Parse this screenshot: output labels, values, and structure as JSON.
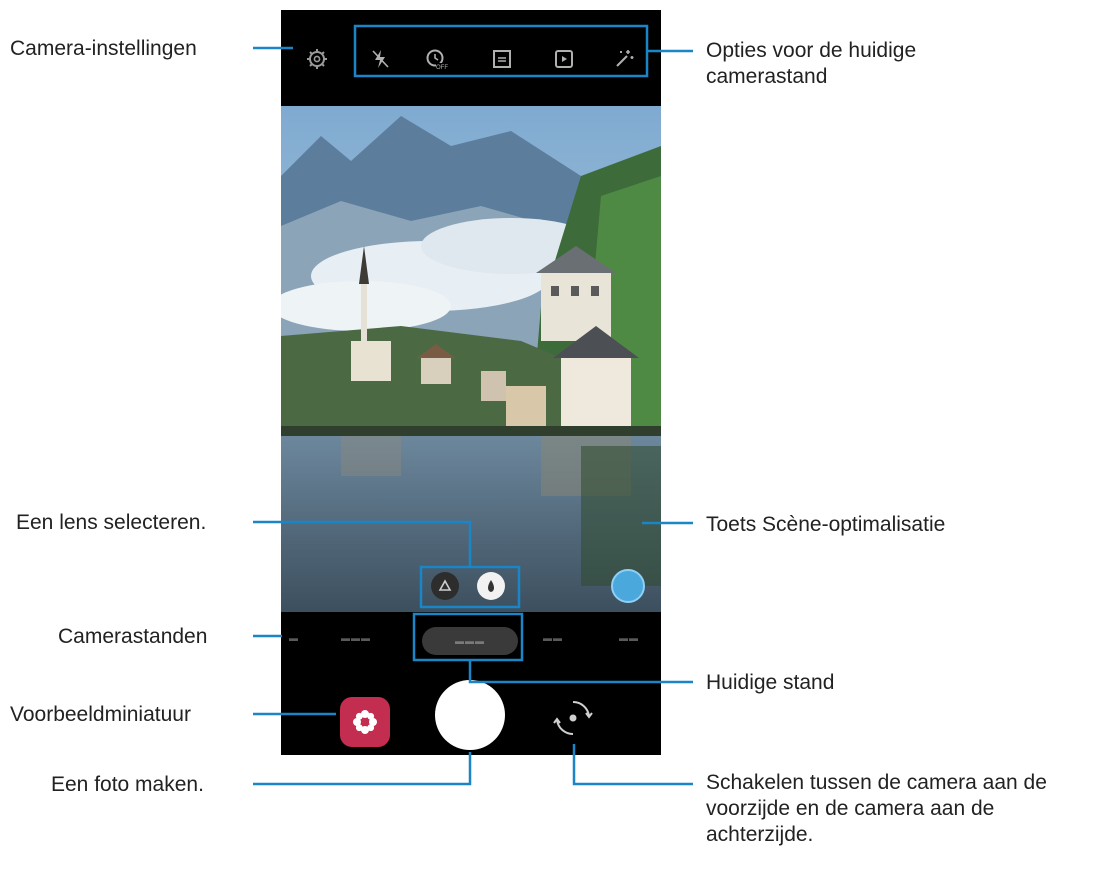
{
  "callouts": {
    "camera_settings": "Camera-instellingen",
    "mode_options": "Opties voor de huidige camerastand",
    "lens_select": "Een lens selecteren.",
    "scene_optimizer": "Toets Scène-optimalisatie",
    "camera_modes": "Camerastanden",
    "current_mode": "Huidige stand",
    "preview_thumbnail": "Voorbeeldminiatuur",
    "take_photo": "Een foto maken.",
    "switch_camera": "Schakelen tussen de camera aan de voorzijde en de camera aan de achterzijde."
  },
  "top_icons": [
    "gear-icon",
    "flash-off-icon",
    "timer-off-icon",
    "aspect-ratio-icon",
    "motion-photo-icon",
    "filter-icon"
  ],
  "lenses": [
    "wide-angle-icon",
    "standard-lens-icon"
  ],
  "colors": {
    "callout_line": "#1a86c7",
    "shutter": "#ffffff",
    "thumbnail": "#c22d50",
    "scene_button": "#4aa8dd"
  }
}
